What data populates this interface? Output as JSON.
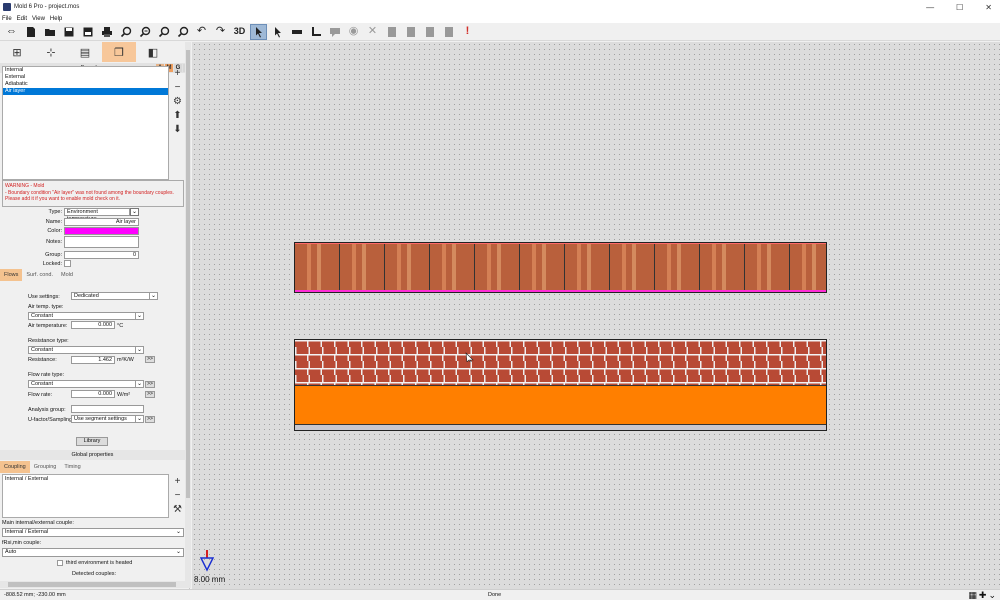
{
  "window": {
    "title": "Mold 6 Pro - project.mos",
    "minimize": "—",
    "maximize": "☐",
    "close": "✕"
  },
  "menu": [
    "File",
    "Edit",
    "View",
    "Help"
  ],
  "toolbar": {
    "three_d_label": "3D",
    "icons": [
      "swap-arrows-icon",
      "new-file-icon",
      "open-folder-icon",
      "save-icon",
      "save-as-icon",
      "print-icon",
      "zoom-in-icon",
      "zoom-out-icon",
      "zoom-fit-icon",
      "zoom-window-icon",
      "undo-icon",
      "redo-icon",
      "3d-view-icon",
      "pointer-icon",
      "pointer-select-icon",
      "ruler-icon",
      "angle-icon",
      "comment-icon",
      "eye-icon",
      "hide-icon",
      "report-icon",
      "chart-icon",
      "results-icon",
      "doc-icon",
      "alert-icon"
    ]
  },
  "left_panel": {
    "mode_tabs": [
      "geometry",
      "dimensions",
      "layers",
      "boundaries",
      "3d"
    ],
    "boundary_header": "Boundary",
    "amg": {
      "a": "A",
      "m": "M",
      "g": "G",
      "q": "?"
    },
    "tools": [
      "brush-icon",
      "pen-icon",
      "delete-box-icon",
      "eyedropper-icon"
    ],
    "boundary_list": {
      "items": [
        "Internal",
        "External",
        "Adiabatic",
        "Air layer"
      ],
      "selected_index": 3
    },
    "warning": {
      "title": "WARNING - Mold",
      "line1": "- Boundary condition \"Air layer\" was not found among the boundary couples.",
      "line2": "Please add it if you want to enable mold check on it."
    },
    "props": {
      "type_label": "Type:",
      "type_value": "Environment temperature",
      "name_label": "Name:",
      "name_value": "Air layer",
      "color_label": "Color:",
      "color_value": "#ff00ff",
      "notes_label": "Notes:",
      "group_label": "Group:",
      "group_value": "0",
      "locked_label": "Locked:"
    },
    "sub_tabs": [
      "Flows",
      "Surf. cond.",
      "Mold"
    ],
    "flows": {
      "use_settings_label": "Use settings:",
      "use_settings_value": "Dedicated",
      "air_temp_type_label": "Air temp. type:",
      "air_temp_type_value": "Constant",
      "air_temp_label": "Air temperature:",
      "air_temp_value": "0.000",
      "air_temp_unit": "°C",
      "resistance_type_label": "Resistance type:",
      "resistance_type_value": "Constant",
      "resistance_label": "Resistance:",
      "resistance_value": "1.462",
      "resistance_unit": "m²K/W",
      "flow_rate_type_label": "Flow rate type:",
      "flow_rate_type_value": "Constant",
      "flow_rate_label": "Flow rate:",
      "flow_rate_value": "0.000",
      "flow_rate_unit": "W/m²",
      "analysis_group_label": "Analysis group:",
      "ufactor_label": "U-factor/Sampling:",
      "ufactor_value": "Use segment settings",
      "more_btn": ">>"
    },
    "library_button": "Library",
    "global_properties": "Global properties",
    "coupling_tabs": [
      "Coupling",
      "Grouping",
      "Timing"
    ],
    "coupling_list": [
      "Internal / External"
    ],
    "main_couple_label": "Main internal/external couple:",
    "main_couple_value": "Internal / External",
    "fRsi_label": "fRsi,min couple:",
    "fRsi_value": "Auto",
    "third_env_label": "third environment is heated",
    "detected_couples_label": "Detected couples:"
  },
  "canvas": {
    "scale_label": "8.00 mm"
  },
  "statusbar": {
    "coords": "-808.52 mm; -230.00 mm",
    "status": "Done"
  }
}
